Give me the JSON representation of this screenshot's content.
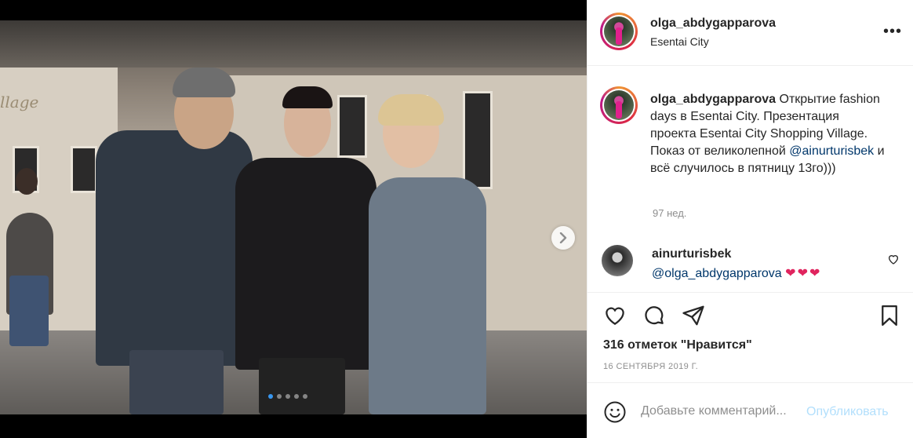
{
  "post": {
    "username": "olga_abdygapparova",
    "location": "Esentai City",
    "more_label": "•••"
  },
  "photo": {
    "sign_text": "llage",
    "carousel": {
      "count": 5,
      "active_index": 0
    }
  },
  "caption": {
    "username": "olga_abdygapparova",
    "text_before_mention": "Открытие fashion days в Esentai City. Презентация проекта Esentai City Shopping Village. Показ от великолепной ",
    "mention": "@ainurturisbek",
    "text_after_mention": " и всё случилось в пятницу 13го)))",
    "time": "97 нед."
  },
  "comment": {
    "username": "ainurturisbek",
    "mention": "@olga_abdygapparova",
    "hearts": "❤❤❤"
  },
  "actions": {
    "likes": "316 отметок \"Нравится\"",
    "date": "16 СЕНТЯБРЯ 2019 Г."
  },
  "add_comment": {
    "placeholder": "Добавьте комментарий...",
    "publish_label": "Опубликовать"
  },
  "colors": {
    "link": "#00376b",
    "muted": "#8e8e8e",
    "publish_disabled": "#b2dffc",
    "dot_active": "#3897f0",
    "heart": "#e0245e"
  }
}
